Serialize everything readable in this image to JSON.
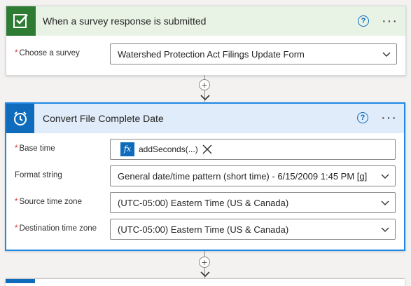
{
  "trigger": {
    "title": "When a survey response is submitted",
    "help": "?",
    "more": "···",
    "fields": [
      {
        "label": "Choose a survey",
        "required": "*",
        "value": "Watershed Protection Act Filings Update Form"
      }
    ]
  },
  "connector1": {
    "add": "+"
  },
  "action": {
    "title": "Convert File Complete Date",
    "help": "?",
    "more": "···",
    "base_time": {
      "label": "Base time",
      "required": "*",
      "token_icon": "fx",
      "token_text": "addSeconds(...)"
    },
    "format_string": {
      "label": "Format string",
      "value": "General date/time pattern (short time) - 6/15/2009 1:45 PM [g]"
    },
    "source_tz": {
      "label": "Source time zone",
      "required": "*",
      "value": "(UTC-05:00) Eastern Time (US & Canada)"
    },
    "dest_tz": {
      "label": "Destination time zone",
      "required": "*",
      "value": "(UTC-05:00) Eastern Time (US & Canada)"
    }
  },
  "connector2": {
    "add": "+"
  },
  "colors": {
    "forms_green": "#2e7b34",
    "accent_blue": "#0f6cbd",
    "selected_border": "#1e88e5",
    "required_red": "#d13438"
  },
  "icons": [
    "forms-check-icon",
    "alarm-clock-icon",
    "help-icon",
    "more-icon",
    "chevron-down-icon",
    "fx-icon",
    "close-icon",
    "plus-icon"
  ]
}
